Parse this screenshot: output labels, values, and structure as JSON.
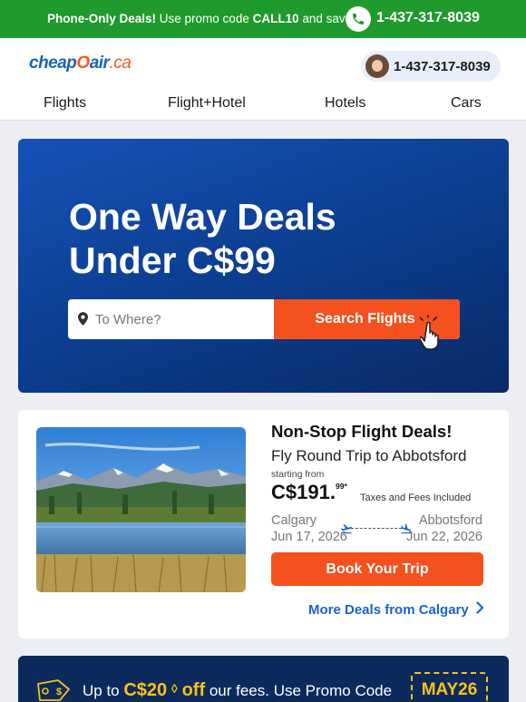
{
  "topbar": {
    "promo_bold": "Phone-Only Deals!",
    "promo_text_1": " Use promo code ",
    "promo_code": "CALL10",
    "promo_text_2": " and save.",
    "phone": "1-437-317-8039"
  },
  "header": {
    "logo_main": "cheap",
    "logo_o": "O",
    "logo_air": "air",
    "logo_ca": ".ca",
    "call_number": "1-437-317-8039",
    "nav": [
      "Flights",
      "Flight+Hotel",
      "Hotels",
      "Cars"
    ]
  },
  "hero": {
    "title": "One Way Deals Under C$99",
    "search_placeholder": "To Where?",
    "search_button": "Search Flights"
  },
  "deal": {
    "title": "Non-Stop Flight Deals!",
    "subtitle": "Fly Round Trip to Abbotsford",
    "starting_from": "starting from",
    "price": "C$191.",
    "cents": "99*",
    "taxes": "Taxes and Fees Included",
    "origin_city": "Calgary",
    "origin_date": "Jun 17, 2026",
    "dest_city": "Abbotsford",
    "dest_date": "Jun 22, 2026",
    "book_button": "Book Your Trip",
    "more_link": "More Deals from Calgary"
  },
  "promo": {
    "text_1": "Up to ",
    "amount": "C$20",
    "off": "off",
    "text_2": " our fees. Use Promo Code",
    "code": "MAY26"
  },
  "colors": {
    "green": "#1f9a2d",
    "brand_blue": "#1a63b8",
    "orange": "#f4511e",
    "navy": "#0c2a5c",
    "gold": "#f9c21a"
  }
}
